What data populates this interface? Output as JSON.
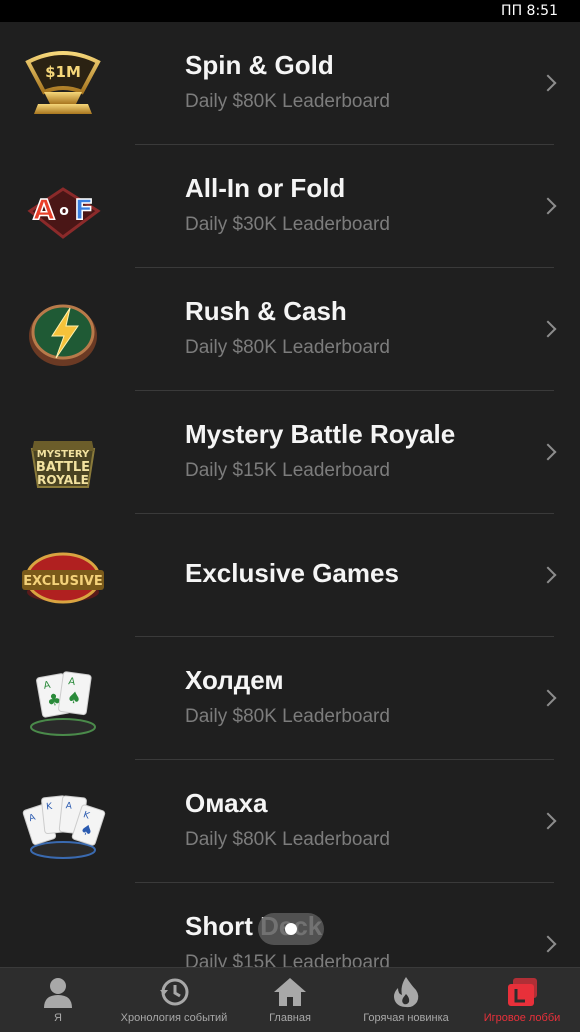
{
  "status_bar": {
    "time": "ПП 8:51"
  },
  "games": [
    {
      "id": "spin-gold",
      "title": "Spin & Gold",
      "subtitle": "Daily $80K Leaderboard",
      "icon": "spin-gold-icon",
      "badge_text": "$1M"
    },
    {
      "id": "all-in-or-fold",
      "title": "All-In or Fold",
      "subtitle": "Daily $30K Leaderboard",
      "icon": "aof-icon",
      "badge_text": "AoF"
    },
    {
      "id": "rush-cash",
      "title": "Rush & Cash",
      "subtitle": "Daily $80K Leaderboard",
      "icon": "lightning-icon"
    },
    {
      "id": "mystery-battle-royale",
      "title": "Mystery Battle Royale",
      "subtitle": "Daily $15K Leaderboard",
      "icon": "mystery-battle-royale-icon",
      "badge_text": "MYSTERY BATTLE ROYALE"
    },
    {
      "id": "exclusive-games",
      "title": "Exclusive Games",
      "subtitle": "",
      "icon": "exclusive-icon",
      "badge_text": "EXCLUSIVE"
    },
    {
      "id": "holdem",
      "title": "Холдем",
      "subtitle": "Daily $80K Leaderboard",
      "icon": "two-cards-icon"
    },
    {
      "id": "omaha",
      "title": "Омаха",
      "subtitle": "Daily $80K Leaderboard",
      "icon": "four-cards-icon"
    },
    {
      "id": "short-deck",
      "title": "Short Deck",
      "subtitle": "Daily $15K Leaderboard",
      "icon": "short-deck-icon"
    }
  ],
  "tabs": [
    {
      "id": "me",
      "label": "Я",
      "icon": "person-icon",
      "active": false
    },
    {
      "id": "history",
      "label": "Хронология событий",
      "icon": "history-icon",
      "active": false
    },
    {
      "id": "home",
      "label": "Главная",
      "icon": "home-icon",
      "active": false
    },
    {
      "id": "hot",
      "label": "Горячая новинка",
      "icon": "flame-icon",
      "active": false
    },
    {
      "id": "lobby",
      "label": "Игровое лобби",
      "icon": "lobby-icon",
      "active": true
    }
  ],
  "colors": {
    "accent": "#e8303a",
    "background": "#1f1f1f",
    "tabbar": "#2d2d2d",
    "subtitle": "#7c7c7c"
  }
}
